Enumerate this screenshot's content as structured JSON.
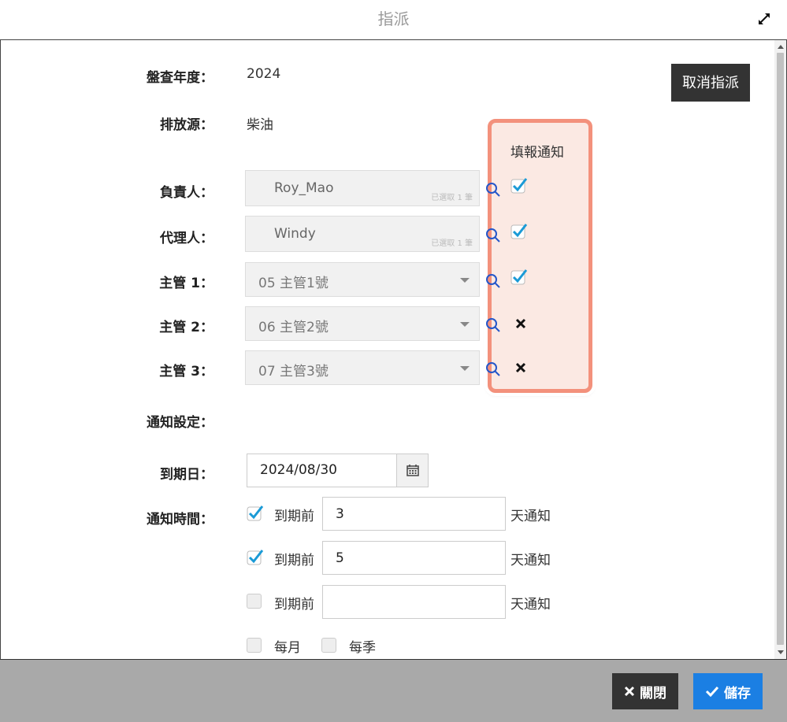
{
  "dialog": {
    "title": "指派"
  },
  "form": {
    "year_label": "盤查年度：",
    "year_value": "2024",
    "source_label": "排放源：",
    "source_value": "柴油",
    "cancel_assign": "取消指派",
    "notify_header": "填報通知",
    "owner_label": "負責人：",
    "owner_value": "Roy_Mao",
    "owner_hint": "已選取 1 筆",
    "agent_label": "代理人：",
    "agent_value": "Windy",
    "agent_hint": "已選取 1 筆",
    "mgr1_label_text": "主管",
    "mgr1_label_num": "1",
    "mgr1_label_colon": "：",
    "mgr1_value": "05 主管1號",
    "mgr2_label_text": "主管",
    "mgr2_label_num": "2",
    "mgr2_label_colon": "：",
    "mgr2_value": "06 主管2號",
    "mgr3_label_text": "主管",
    "mgr3_label_num": "3",
    "mgr3_label_colon": "：",
    "mgr3_value": "07 主管3號",
    "notify_settings_label": "通知設定：",
    "due_label": "到期日：",
    "due_value": "2024/08/30",
    "notify_time_label": "通知時間：",
    "reminders": [
      {
        "checked": true,
        "prefix": "到期前",
        "days": "3",
        "suffix": "天通知"
      },
      {
        "checked": true,
        "prefix": "到期前",
        "days": "5",
        "suffix": "天通知"
      },
      {
        "checked": false,
        "prefix": "到期前",
        "days": "",
        "suffix": "天通知"
      }
    ],
    "monthly_label": "每月",
    "quarterly_label": "每季"
  },
  "notify_flags": {
    "owner": true,
    "agent": true,
    "mgr1": true,
    "mgr2": false,
    "mgr3": false
  },
  "footer": {
    "close_label": "關閉",
    "save_label": "儲存"
  },
  "colors": {
    "accent": "#1b7fe3",
    "check": "#1a9ad6",
    "highlight_border": "#f3917c",
    "highlight_fill": "#fbe9e3",
    "dark_button": "#333333"
  }
}
